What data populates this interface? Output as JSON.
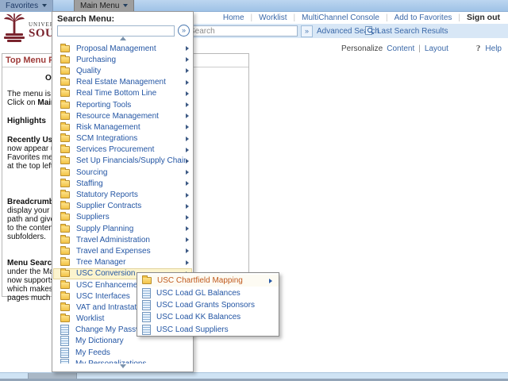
{
  "colors": {
    "maroon": "#7a242e",
    "menu_link_blue": "#2456a4",
    "hover_orange": "#c05a1e",
    "highlight_row_bg": "#fcf4ce",
    "search_band_bg": "#d8e7f6",
    "top_bar_bg": "#a9c7e8",
    "pagelet_title_red": "#9e3a38"
  },
  "icons": {
    "favorites_caret": "chevron-down",
    "main_menu_caret": "chevron-down",
    "menu_scroll_up": "triangle-up",
    "menu_scroll_down": "triangle-down",
    "submenu_expand": "triangle-right",
    "search_go": "double-chevron-right",
    "menu_search_go": "double-chevron-right-circle",
    "last_search_results": "magnifier",
    "help": "question-mark",
    "menu_folder": "folder",
    "menu_page": "page"
  },
  "top_bar": {
    "favorites_label": "Favorites",
    "main_menu_label": "Main Menu"
  },
  "header": {
    "logo": {
      "line1": "UNIVERS",
      "line2": "SOUT"
    },
    "nav_links": [
      "Home",
      "Worklist",
      "MultiChannel Console",
      "Add to Favorites"
    ],
    "sign_out_label": "Sign out",
    "search": {
      "value": "Search",
      "go_label": "»",
      "advanced_label": "Advanced Search",
      "last_results_label": "Last Search Results"
    }
  },
  "personalize_bar": {
    "prefix": "Personalize",
    "links": [
      "Content",
      "Layout"
    ],
    "separator": "|",
    "help_icon": "?",
    "help_label": "Help"
  },
  "pagelet": {
    "title": "Top Menu Feat",
    "paragraphs": [
      [
        [
          {
            "t": "O",
            "b": true
          }
        ]
      ],
      [
        [
          {
            "t": "The menu is no"
          }
        ],
        [
          {
            "t": "Click on "
          },
          {
            "t": "Main M",
            "b": true
          }
        ]
      ],
      [
        [
          {
            "t": "Highlights",
            "b": true
          }
        ]
      ],
      [
        [
          {
            "t": "Recently Used",
            "b": true
          }
        ],
        [
          {
            "t": "now appear un"
          }
        ],
        [
          {
            "t": "Favorites menu"
          }
        ],
        [
          {
            "t": "at the top left."
          }
        ]
      ],
      [
        [
          {
            "t": "Breadcrumbs",
            "b": true
          }
        ],
        [
          {
            "t": "display your na"
          }
        ],
        [
          {
            "t": "path and give y"
          }
        ],
        [
          {
            "t": "to the contents"
          }
        ],
        [
          {
            "t": "subfolders."
          }
        ]
      ],
      [
        [
          {
            "t": "Menu Search,",
            "b": true
          }
        ],
        [
          {
            "t": "under the Main"
          }
        ],
        [
          {
            "t": "now supports t"
          }
        ],
        [
          {
            "t": "which makes fi"
          }
        ],
        [
          {
            "t": "pages much fa"
          }
        ]
      ]
    ]
  },
  "menu": {
    "title": "Search Menu:",
    "search_value": "",
    "go_label": "»",
    "items": [
      {
        "label": "Proposal Management",
        "icon": "folder",
        "arrow": true
      },
      {
        "label": "Purchasing",
        "icon": "folder",
        "arrow": true
      },
      {
        "label": "Quality",
        "icon": "folder",
        "arrow": true
      },
      {
        "label": "Real Estate Management",
        "icon": "folder",
        "arrow": true
      },
      {
        "label": "Real Time Bottom Line",
        "icon": "folder",
        "arrow": true
      },
      {
        "label": "Reporting Tools",
        "icon": "folder",
        "arrow": true
      },
      {
        "label": "Resource Management",
        "icon": "folder",
        "arrow": true
      },
      {
        "label": "Risk Management",
        "icon": "folder",
        "arrow": true
      },
      {
        "label": "SCM Integrations",
        "icon": "folder",
        "arrow": true
      },
      {
        "label": "Services Procurement",
        "icon": "folder",
        "arrow": true
      },
      {
        "label": "Set Up Financials/Supply Chain",
        "icon": "folder",
        "arrow": true
      },
      {
        "label": "Sourcing",
        "icon": "folder",
        "arrow": true
      },
      {
        "label": "Staffing",
        "icon": "folder",
        "arrow": true
      },
      {
        "label": "Statutory Reports",
        "icon": "folder",
        "arrow": true
      },
      {
        "label": "Supplier Contracts",
        "icon": "folder",
        "arrow": true
      },
      {
        "label": "Suppliers",
        "icon": "folder",
        "arrow": true
      },
      {
        "label": "Supply Planning",
        "icon": "folder",
        "arrow": true
      },
      {
        "label": "Travel Administration",
        "icon": "folder",
        "arrow": true
      },
      {
        "label": "Travel and Expenses",
        "icon": "folder",
        "arrow": true
      },
      {
        "label": "Tree Manager",
        "icon": "folder",
        "arrow": true
      },
      {
        "label": "USC Conversion",
        "icon": "folder",
        "arrow": true,
        "highlighted": true
      },
      {
        "label": "USC Enhancements",
        "icon": "folder",
        "arrow": true
      },
      {
        "label": "USC Interfaces",
        "icon": "folder",
        "arrow": true
      },
      {
        "label": "VAT and Intrastat",
        "icon": "folder",
        "arrow": true
      },
      {
        "label": "Worklist",
        "icon": "folder",
        "arrow": true
      },
      {
        "label": "Change My Password",
        "icon": "page",
        "arrow": false
      },
      {
        "label": "My Dictionary",
        "icon": "page",
        "arrow": false
      },
      {
        "label": "My Feeds",
        "icon": "page",
        "arrow": false
      },
      {
        "label": "My Personalizations",
        "icon": "page",
        "arrow": false
      }
    ]
  },
  "submenu": {
    "items": [
      {
        "label": "USC Chartfield Mapping",
        "icon": "folder",
        "arrow": true,
        "hovered": true
      },
      {
        "label": "USC Load GL Balances",
        "icon": "page",
        "arrow": false
      },
      {
        "label": "USC Load Grants Sponsors",
        "icon": "page",
        "arrow": false
      },
      {
        "label": "USC Load KK Balances",
        "icon": "page",
        "arrow": false
      },
      {
        "label": "USC Load Suppliers",
        "icon": "page",
        "arrow": false
      }
    ]
  }
}
